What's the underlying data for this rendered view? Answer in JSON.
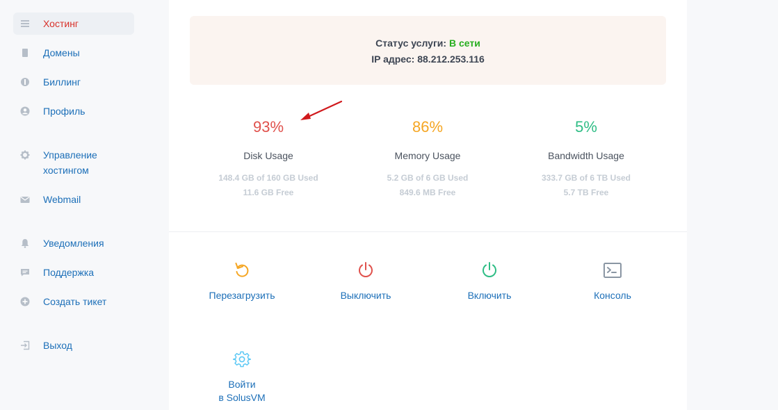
{
  "sidebar": {
    "items": [
      {
        "label": "Хостинг",
        "icon": "list-icon",
        "active": true
      },
      {
        "label": "Домены",
        "icon": "document-icon"
      },
      {
        "label": "Биллинг",
        "icon": "billing-icon"
      },
      {
        "label": "Профиль",
        "icon": "user-icon"
      },
      {
        "label_line1": "Управление",
        "label_line2": "хостингом",
        "icon": "gear-icon"
      },
      {
        "label": "Webmail",
        "icon": "mail-icon"
      },
      {
        "label": "Уведомления",
        "icon": "bell-icon"
      },
      {
        "label": "Поддержка",
        "icon": "chat-icon"
      },
      {
        "label": "Создать тикет",
        "icon": "plus-circle-icon"
      },
      {
        "label": "Выход",
        "icon": "logout-icon"
      }
    ]
  },
  "status": {
    "label": "Статус услуги:",
    "value": "В сети",
    "ip_label": "IP адрес:",
    "ip_value": "88.212.253.116"
  },
  "usage": [
    {
      "percent": "93%",
      "label": "Disk Usage",
      "used": "148.4 GB of 160 GB Used",
      "free": "11.6 GB Free",
      "color": "#e0514c"
    },
    {
      "percent": "86%",
      "label": "Memory Usage",
      "used": "5.2 GB of 6 GB Used",
      "free": "849.6 MB Free",
      "color": "#f5a623"
    },
    {
      "percent": "5%",
      "label": "Bandwidth Usage",
      "used": "333.7 GB of 6 TB Used",
      "free": "5.7 TB Free",
      "color": "#2ebd85"
    }
  ],
  "actions": [
    {
      "label": "Перезагрузить",
      "icon": "restart-icon",
      "color": "#f5a623"
    },
    {
      "label": "Выключить",
      "icon": "power-off-icon",
      "color": "#e0514c"
    },
    {
      "label": "Включить",
      "icon": "power-on-icon",
      "color": "#2ebd85"
    },
    {
      "label": "Консоль",
      "icon": "console-icon",
      "color": "#8a96a3"
    },
    {
      "label_line1": "Войти",
      "label_line2": "в SolusVM",
      "icon": "settings-icon",
      "color": "#5bc8f5"
    }
  ],
  "colors": {
    "accent": "#1c6fb8",
    "active_nav": "#d8312a",
    "status_ok": "#27ae1f",
    "annotation_arrow": "#d0191c"
  }
}
